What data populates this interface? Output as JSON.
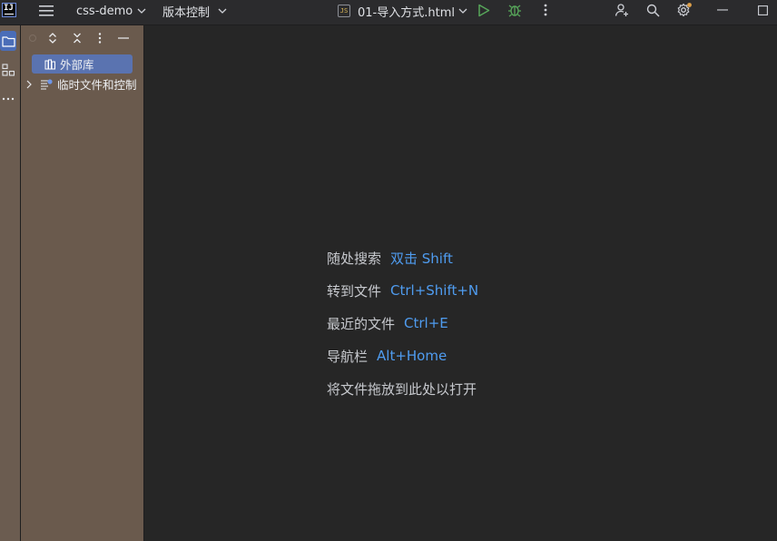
{
  "titlebar": {
    "project_name": "css-demo",
    "vcs_label": "版本控制",
    "file_type_badge": "JS",
    "current_file": "01-导入方式.html"
  },
  "sidebar": {
    "items": [
      {
        "label": "外部库"
      },
      {
        "label": "临时文件和控制"
      }
    ]
  },
  "editor": {
    "hints": [
      {
        "text": "随处搜索",
        "shortcut": "双击 Shift"
      },
      {
        "text": "转到文件",
        "shortcut": "Ctrl+Shift+N"
      },
      {
        "text": "最近的文件",
        "shortcut": "Ctrl+E"
      },
      {
        "text": "导航栏",
        "shortcut": "Alt+Home"
      },
      {
        "text": "将文件拖放到此处以打开"
      }
    ]
  },
  "colors": {
    "editor_bg": "#262626",
    "titlebar_bg": "#2b2b2d",
    "panel_bg": "#6a5a4d",
    "shortcut_blue": "#4f9cf0",
    "run_green": "#57a65a"
  }
}
